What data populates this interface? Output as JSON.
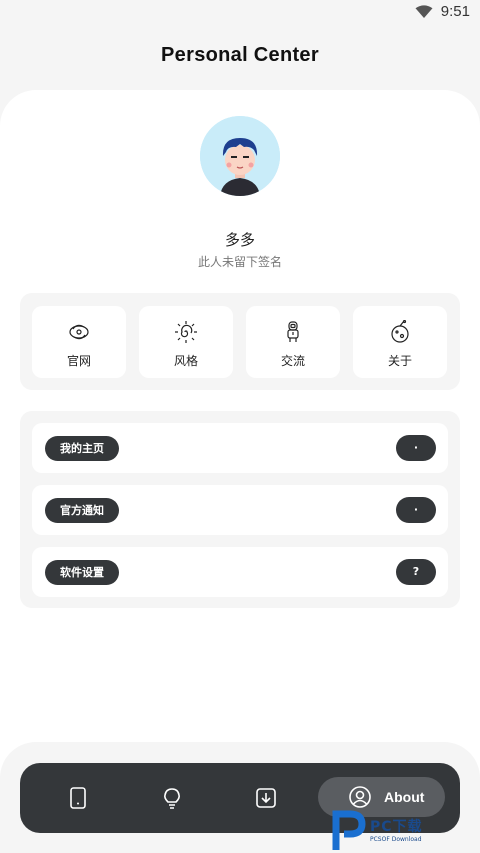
{
  "status_bar": {
    "time": "9:51",
    "icons": [
      "wifi-icon"
    ]
  },
  "header": {
    "title": "Personal Center"
  },
  "profile": {
    "name": "多多",
    "signature": "此人未留下签名",
    "avatar_bg": "#c9ecf9"
  },
  "shortcuts": [
    {
      "label": "官网",
      "icon": "galaxy-icon"
    },
    {
      "label": "风格",
      "icon": "spiral-sun-icon"
    },
    {
      "label": "交流",
      "icon": "astronaut-icon"
    },
    {
      "label": "关于",
      "icon": "planet-icon"
    }
  ],
  "menu": [
    {
      "label": "我的主页",
      "badge": "·"
    },
    {
      "label": "官方通知",
      "badge": "·"
    },
    {
      "label": "软件设置",
      "badge": "?"
    }
  ],
  "bottom_nav": {
    "items": [
      "tablet-icon",
      "bulb-icon",
      "download-icon"
    ],
    "active": {
      "label": "About",
      "icon": "user-icon"
    }
  },
  "watermark": {
    "text": "PC下载",
    "sub": "PCSOF Download"
  },
  "colors": {
    "background": "#f5f5f5",
    "card": "#ffffff",
    "dark": "#34373a",
    "accent": "#c9ecf9"
  }
}
